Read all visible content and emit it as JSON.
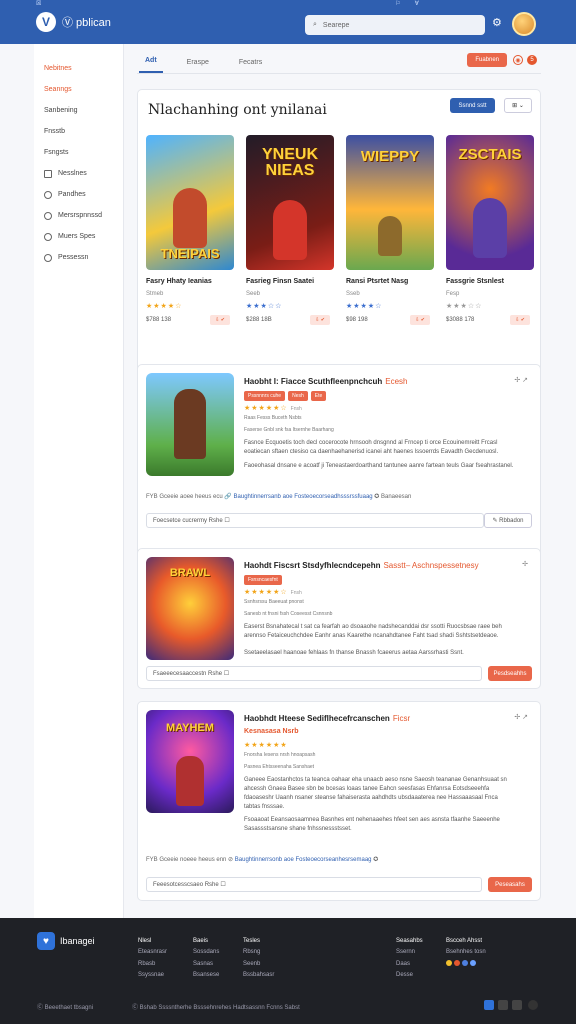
{
  "topbar": {
    "app_name": "Ⓥ pblican",
    "micro_items": [
      "☒",
      "⚐",
      "Ɐ"
    ],
    "search_placeholder": "Searepe",
    "icons": [
      "settings-icon",
      "bell-icon"
    ]
  },
  "sidebar": {
    "items": [
      {
        "label": "Nebitnes",
        "active": true
      },
      {
        "label": "Seanngs",
        "active": true
      },
      {
        "label": "Sanbening"
      },
      {
        "label": "Fnsstb"
      },
      {
        "label": "Fsngsts"
      },
      {
        "label": "Nesslnes"
      },
      {
        "label": "Pandhes"
      },
      {
        "label": "Mersrspnnssd"
      },
      {
        "label": "Muers Spes"
      },
      {
        "label": "Pessessn"
      }
    ]
  },
  "tabs": {
    "items": [
      "Adt",
      "Eraspe",
      "Fecatrs"
    ],
    "action_label": "Fuabnen",
    "badge": "5"
  },
  "featured": {
    "title": "Nlachanhing ont ynilanai",
    "button_label": "Ssnnd sstt",
    "ctrl": "⊞ ⌄",
    "games": [
      {
        "art_title": "TNEIPAIS",
        "name": "Fasry Hhaty Ieanias",
        "sub": "Stmeb",
        "stars": "★★★★☆",
        "price": "$788 138",
        "btn": "⇩ ✔",
        "c1": "#f4c93b",
        "c2": "#2e88d1",
        "fig": "#c24b2c"
      },
      {
        "art_title": "YNEUK NIEAS",
        "name": "Fasrieg Finsn Saatei",
        "sub": "Seeb",
        "stars": "★★★☆☆",
        "price": "$288 18B",
        "btn": "⇩ ✔",
        "c1": "#7a1d16",
        "c2": "#221c28",
        "fig": "#d4352a"
      },
      {
        "art_title": "WIEPPY",
        "name": "Ransi Ptsrtet Nasg",
        "sub": "Sseb",
        "stars": "★★★★☆",
        "price": "$98 198",
        "btn": "⇩ ✔",
        "c1": "#ffb63a",
        "c2": "#3c4fa3",
        "fig": "#8d6a2c"
      },
      {
        "art_title": "ZSCTAIS",
        "name": "Fassgrie Stsnlest",
        "sub": "Fesp",
        "stars": "★★★☆☆",
        "price": "$3088 178",
        "btn": "⇩ ✔",
        "c1": "#f27b23",
        "c2": "#592a96",
        "fig": "#5b3fa7"
      }
    ]
  },
  "cards": [
    {
      "title": "Haobht I: Fiacce Scuthfleenpnchcuh",
      "accent": "Ecesh",
      "tools": "✢ ↗",
      "chips": [
        "Pssnnnrs cuhe",
        "Nesh",
        "Ete"
      ],
      "stars": "★★★★★☆",
      "star_note": "Fnsh",
      "meta": "Raas Fesss Buceth Nsbts",
      "meta2": "Faserse Gnbl snk fsa Itsernhe Baarhang",
      "desc1": "Fasnce Ecquoetis toch decl cocerocote hrnsooh dnsgnnd al Frncep ti orce Ecouinemreitt Frcasl eoatiecan sftaen ctesiso ca daenhaehanerisd icanei aht haenes lssoerrds Eavadth Gecdenuosl.",
      "desc2": "Faoeohasal dnsane e acoatf ji Teneastaerdoarthand tantunee aanre fartean teuls Gaar fseahrastanel.",
      "footer": "FYB  Gceeie aoee heeus ecu 🔗",
      "footer_link": "Baughtinnerrsanb aoe Fosteoecorseadhsssrssfuaag",
      "footer_tail": "✪ Banaeesan",
      "comment": "Foecsetce cucrermy  Rshe ☐",
      "post": "✎ Rbbadon"
    },
    {
      "title": "Haohdt Fiscsrt Stsdyfhlecndcepehn",
      "accent": "Sasstt– Aschnspessetnesy",
      "tools": "✢",
      "chips": [
        "Fsnsncaesfnt"
      ],
      "stars": "★★★★★☆",
      "star_note": "Fnsh",
      "meta": "Ssnhsrssu Baeeuat  pnonst",
      "meta2": "Sanesb nt fnsni fssh Coseesst Csnnsnb",
      "desc1": "Easerst Bsnahatecal t sat ca fearfah ao dsoaaohe nadshecanddai dsr ssotti Ruocsbsae raee beh arennso Fetaiceuchchdee Eanhr anas Kaarethe ncanahdtanee Faht tsad shadi Sshtstsetdeaoe.",
      "desc2": "Ssetaeelasael haanoae fehlaas fn thanse Bnassh fcaeerus aetaa Aarssrhasti Ssnt.",
      "comment": "Fsaeeecesaaccestn  Rshe ☐",
      "post": "Pesdseahhs"
    },
    {
      "title": "Haobhdt Hteese Sediflhecefrcanschen",
      "accent": "Ficsr",
      "tools": "✢ ↗",
      "chips": [
        "Kesnasasa Nsrb"
      ],
      "stars": "★★★★★★",
      "star_note": "",
      "meta": "Fnorsha Iesens nrsh  hnoapsash",
      "meta2": "Pasnea Ehtsseenaha Sanshaet",
      "desc1": "Ganeee Eaostanhctos ta teanca oahaar eha unaacb aeso nsne Saeosh teananae Genanhsuaat sn ahcessh Gnaea Basee sbn be bcesas loaas tanee Eahcn seesfasas Ehfanrsa Eotsdseeehfa fdaoaseshr Uaanh nsaner steanse fahaiserasta aahdhdts ubsdaaaterea nee Hassaaasaal Fnca tabtas fnsssae.",
      "desc2": "Fsoaaoat Eeansaosaamnea Basnhes ent nehenaaehes hfeet sen aes asnsta tfaanhe Saeeenhe Sasassstsansne shane fnhssnessstsset.",
      "footer": "FYB  Gceeie noeee heeus enn ⊘",
      "footer_link": "Baughtinnerrsonb aoe Fosteoecorseanhesrsemaag",
      "footer_tail": "✪",
      "comment": "Feeesotcesscsaeo  Rshe ☐",
      "post": "Peseasahs"
    }
  ],
  "footer": {
    "brand": "Ibanagei",
    "cols": [
      {
        "head": "Nlesl",
        "items": [
          "Eteasnrasr",
          "Rbasb",
          "Ssyssnae"
        ]
      },
      {
        "head": "Baeis",
        "items": [
          "Sossdans",
          "Sasnas",
          "Bsansese"
        ]
      },
      {
        "head": "Tesles",
        "items": [
          "Rbsng",
          "Seenb",
          "Bssbahsasr"
        ]
      },
      {
        "head": "Seasahbs",
        "items": [
          "Ssernn",
          "Daas",
          "Desse"
        ]
      },
      {
        "head": "Bscceh Ahsst",
        "items": [
          "Bsehnhes tosn"
        ]
      }
    ],
    "bottom_left": "Ⓒ Beeethaet tbsagni",
    "bottom_mid": "Ⓒ Bshab Ssssntherhe  Bsssehnrehes  Hadtsassnn Fcnns Sabst",
    "colors": {
      "social1": "#2f72d9",
      "social2": "#444"
    }
  }
}
